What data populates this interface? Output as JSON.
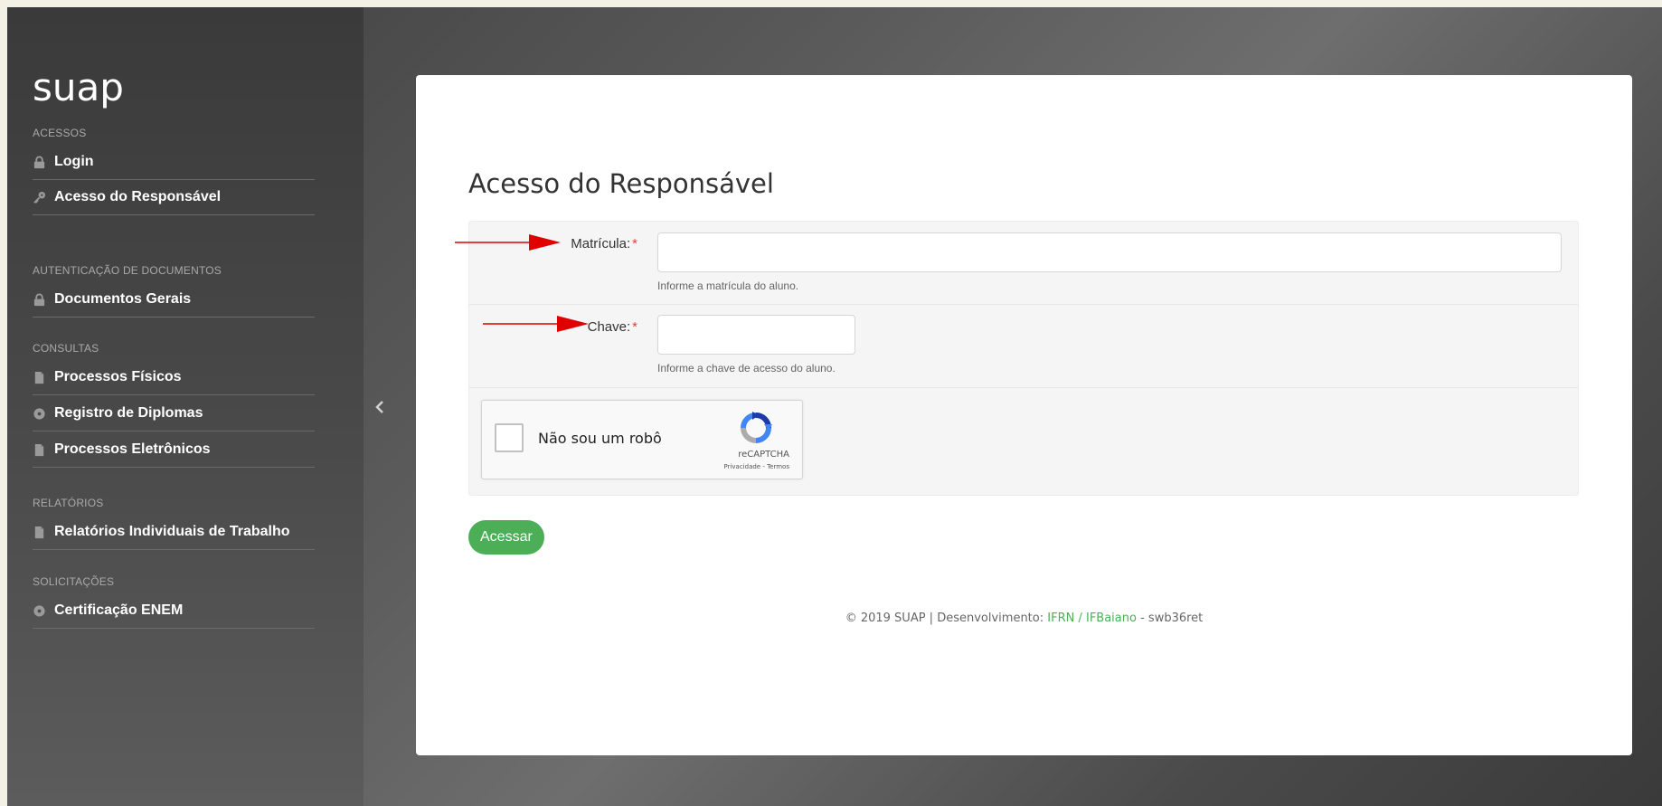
{
  "sidebar": {
    "logo": "suap",
    "sections": [
      {
        "title": "ACESSOS",
        "items": [
          {
            "label": "Login",
            "icon": "lock-icon"
          },
          {
            "label": "Acesso do Responsável",
            "icon": "key-icon"
          }
        ]
      },
      {
        "title": "AUTENTICAÇÃO DE DOCUMENTOS",
        "items": [
          {
            "label": "Documentos Gerais",
            "icon": "lock-icon"
          }
        ]
      },
      {
        "title": "CONSULTAS",
        "items": [
          {
            "label": "Processos Físicos",
            "icon": "document-icon"
          },
          {
            "label": "Registro de Diplomas",
            "icon": "gear-icon"
          },
          {
            "label": "Processos Eletrônicos",
            "icon": "document-icon"
          }
        ]
      },
      {
        "title": "RELATÓRIOS",
        "items": [
          {
            "label": "Relatórios Individuais de Trabalho",
            "icon": "document-icon"
          }
        ]
      },
      {
        "title": "SOLICITAÇÕES",
        "items": [
          {
            "label": "Certificação ENEM",
            "icon": "gear-icon"
          }
        ]
      }
    ],
    "collapse_icon": "chevron-left-icon"
  },
  "main": {
    "title": "Acesso do Responsável",
    "form": {
      "matricula": {
        "label": "Matrícula:",
        "required_mark": "*",
        "value": "",
        "help": "Informe a matrícula do aluno."
      },
      "chave": {
        "label": "Chave:",
        "required_mark": "*",
        "value": "",
        "help": "Informe a chave de acesso do aluno."
      },
      "recaptcha": {
        "label": "Não sou um robô",
        "brand": "reCAPTCHA",
        "links": "Privacidade - Termos",
        "checked": false
      }
    },
    "submit_label": "Acessar",
    "footer": {
      "prefix": "© 2019 SUAP | Desenvolvimento:",
      "link": "IFRN / IFBaiano",
      "suffix": "- swb36ret"
    }
  },
  "colors": {
    "accent_green": "#4cae57",
    "required_red": "#e0413a",
    "annotation_arrow": "#e00000"
  }
}
